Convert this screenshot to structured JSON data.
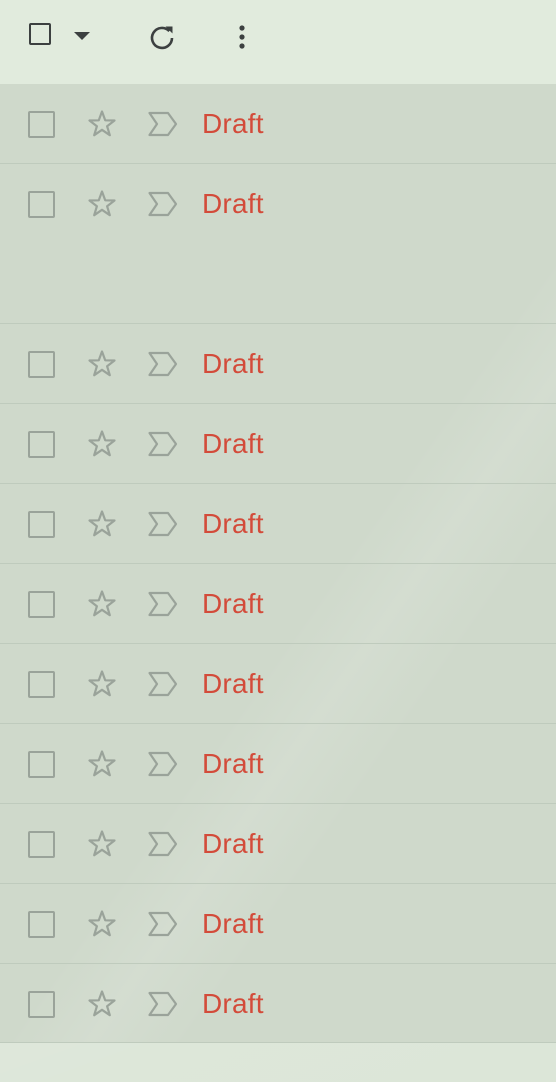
{
  "toolbar": {
    "icons": [
      "select-all-checkbox",
      "select-dropdown-caret",
      "refresh-icon",
      "more-options-icon"
    ]
  },
  "messages": [
    {
      "label": "Draft"
    },
    {
      "label": "Draft"
    },
    {
      "label": "Draft"
    },
    {
      "label": "Draft"
    },
    {
      "label": "Draft"
    },
    {
      "label": "Draft"
    },
    {
      "label": "Draft"
    },
    {
      "label": "Draft"
    },
    {
      "label": "Draft"
    },
    {
      "label": "Draft"
    },
    {
      "label": "Draft"
    }
  ],
  "colors": {
    "draft_label": "#d34b3a",
    "icon_gray": "#9aa39a",
    "toolbar_icon": "#3c4040",
    "list_bg": "#cfd9cb",
    "toolbar_bg": "#e1ebdd"
  }
}
